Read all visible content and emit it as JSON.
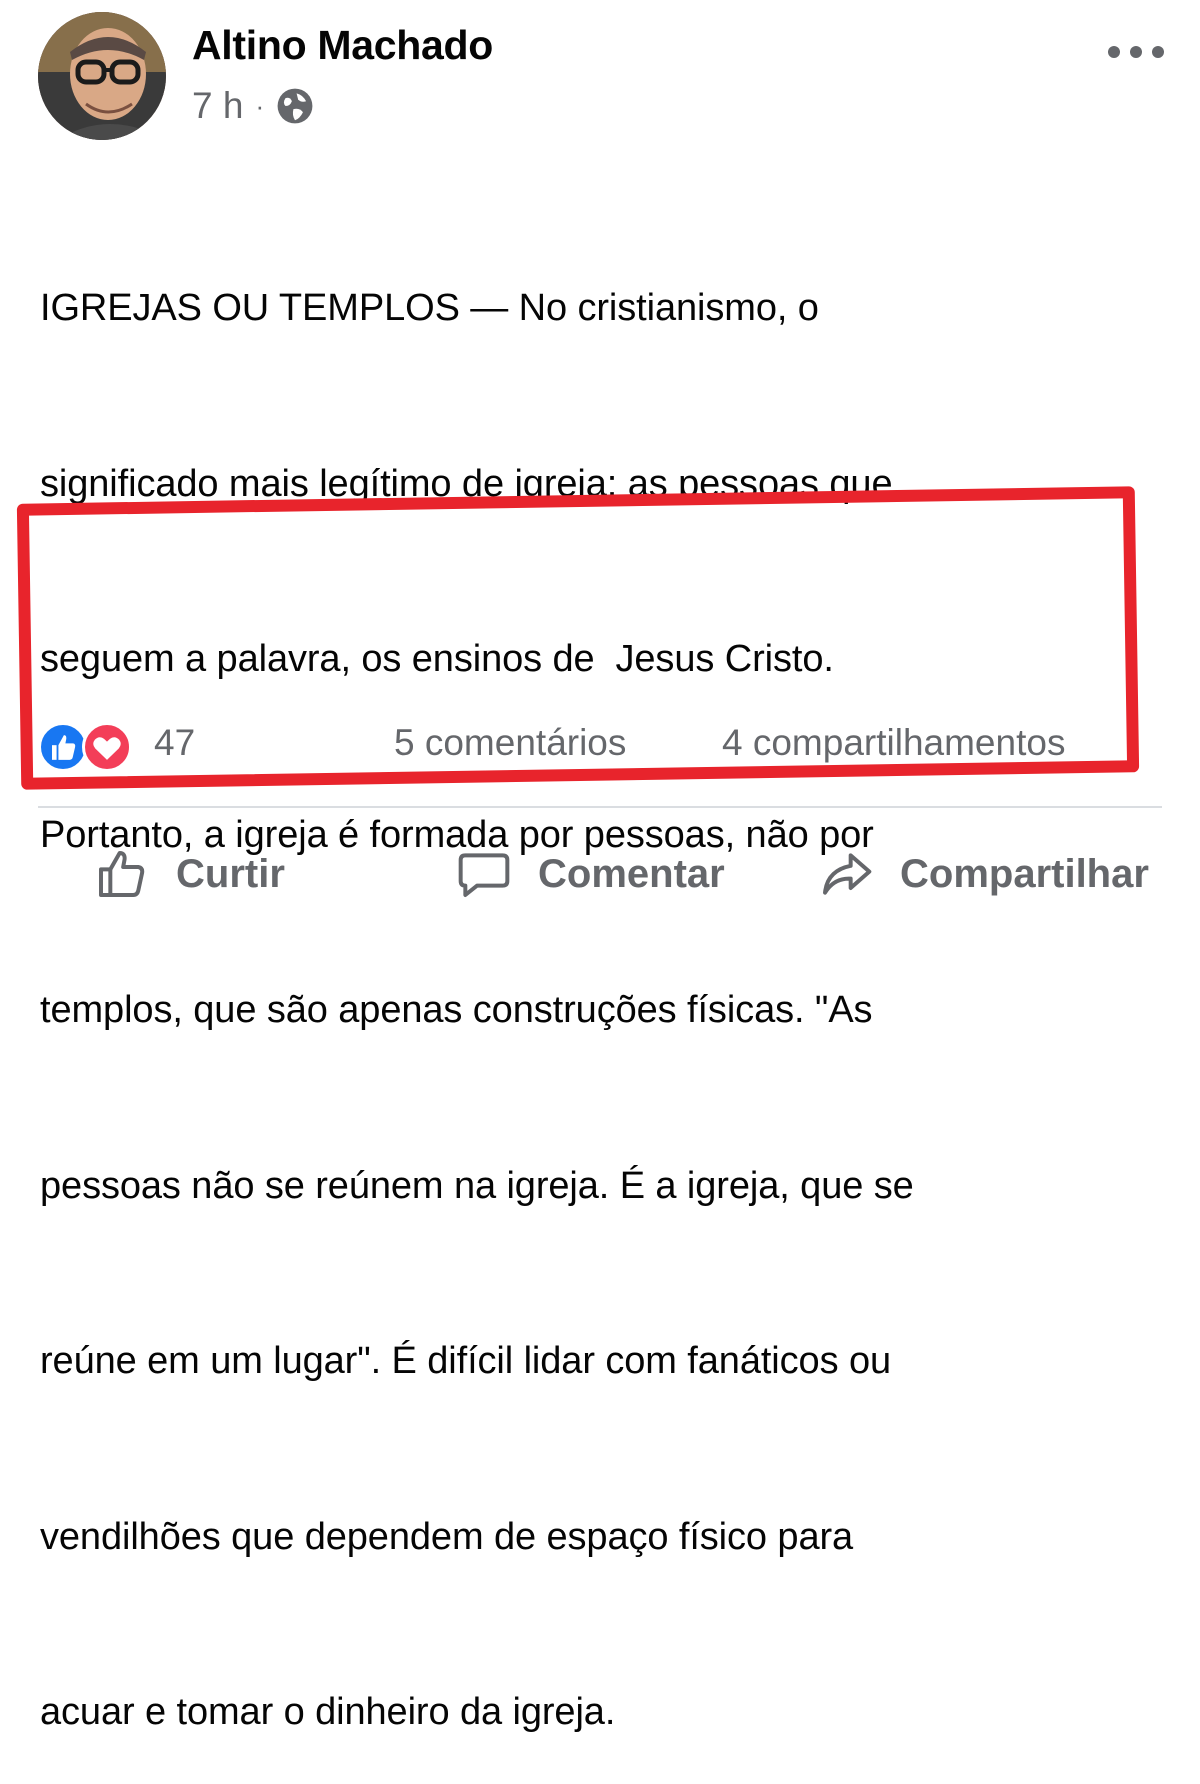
{
  "post": {
    "author": "Altino Machado",
    "time": "7 h",
    "separator": "·",
    "audience_icon": "globe-icon",
    "menu_icon": "more-options-icon",
    "text_lines": [
      "IGREJAS OU TEMPLOS — No cristianismo, o",
      "significado mais legítimo de igreja: as pessoas que",
      "seguem a palavra, os ensinos de  Jesus Cristo.",
      "Portanto, a igreja é formada por pessoas, não por",
      "templos, que são apenas construções físicas. \"As",
      "pessoas não se reúnem na igreja. É a igreja, que se",
      "reúne em um lugar\". É difícil lidar com fanáticos ou",
      "vendilhões que dependem de espaço físico para",
      "acuar e tomar o dinheiro da igreja."
    ]
  },
  "stats": {
    "reaction_icons": [
      "like-reaction-icon",
      "love-reaction-icon"
    ],
    "reaction_count": "47",
    "comments": "5 comentários",
    "shares": "4 compartilhamentos"
  },
  "actions": {
    "like": "Curtir",
    "comment": "Comentar",
    "share": "Compartilhar"
  },
  "colors": {
    "highlight": "#e8242c",
    "like_blue": "#1877f2",
    "love_red": "#f33e58",
    "secondary_text": "#65676b"
  }
}
